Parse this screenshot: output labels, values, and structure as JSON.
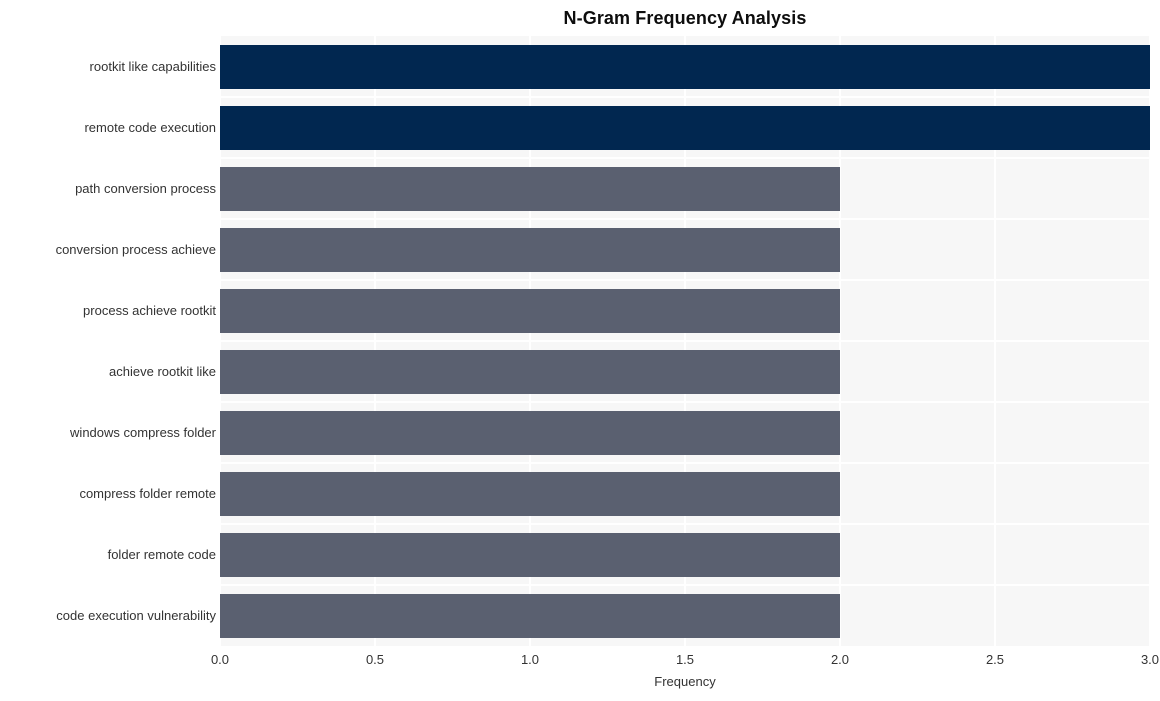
{
  "chart_data": {
    "type": "bar",
    "orientation": "horizontal",
    "title": "N-Gram Frequency Analysis",
    "xlabel": "Frequency",
    "ylabel": "",
    "xlim": [
      0,
      3.0
    ],
    "xticks": [
      "0.0",
      "0.5",
      "1.0",
      "1.5",
      "2.0",
      "2.5",
      "3.0"
    ],
    "xtick_values": [
      0.0,
      0.5,
      1.0,
      1.5,
      2.0,
      2.5,
      3.0
    ],
    "grid": true,
    "grid_color": "#ffffff",
    "plot_background": "#f7f7f7",
    "legend": "none",
    "categories": [
      "rootkit like capabilities",
      "remote code execution",
      "path conversion process",
      "conversion process achieve",
      "process achieve rootkit",
      "achieve rootkit like",
      "windows compress folder",
      "compress folder remote",
      "folder remote code",
      "code execution vulnerability"
    ],
    "values": [
      3,
      3,
      2,
      2,
      2,
      2,
      2,
      2,
      2,
      2
    ],
    "bar_colors": [
      "#012750",
      "#012750",
      "#5a6070",
      "#5a6070",
      "#5a6070",
      "#5a6070",
      "#5a6070",
      "#5a6070",
      "#5a6070",
      "#5a6070"
    ]
  }
}
